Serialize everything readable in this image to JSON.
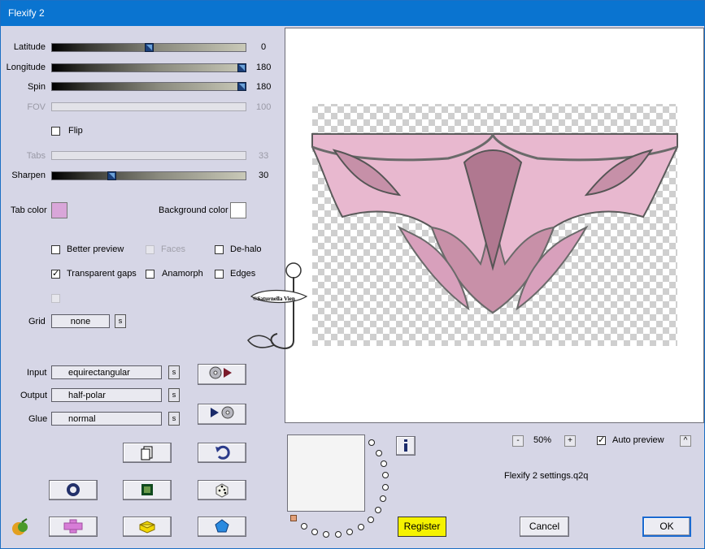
{
  "window": {
    "title": "Flexify 2"
  },
  "sliders": {
    "latitude": {
      "label": "Latitude",
      "value": "0",
      "fraction": 0.5
    },
    "longitude": {
      "label": "Longitude",
      "value": "180",
      "fraction": 1.0
    },
    "spin": {
      "label": "Spin",
      "value": "180",
      "fraction": 1.0
    },
    "fov": {
      "label": "FOV",
      "value": "100",
      "fraction": 1.0
    },
    "tabs": {
      "label": "Tabs",
      "value": "33",
      "fraction": 0.33
    },
    "sharpen": {
      "label": "Sharpen",
      "value": "30",
      "fraction": 0.3
    }
  },
  "checkboxes": {
    "flip": {
      "label": "Flip",
      "checked": false
    },
    "better_preview": {
      "label": "Better preview",
      "checked": false
    },
    "faces": {
      "label": "Faces",
      "checked": false
    },
    "de_halo": {
      "label": "De-halo",
      "checked": false
    },
    "transparent_gaps": {
      "label": "Transparent gaps",
      "checked": true
    },
    "anamorph": {
      "label": "Anamorph",
      "checked": false
    },
    "edges": {
      "label": "Edges",
      "checked": false
    },
    "auto_preview": {
      "label": "Auto preview",
      "checked": true
    }
  },
  "colors": {
    "tab_color_label": "Tab color",
    "tab_color": "#d9a6d9",
    "background_color_label": "Background color",
    "background_color": "#ffffff",
    "accent": "#1b6ad0",
    "title_bar": "#0a74d0"
  },
  "grid": {
    "label": "Grid",
    "value": "none"
  },
  "projections": {
    "input": {
      "label": "Input",
      "value": "equirectangular"
    },
    "output": {
      "label": "Output",
      "value": "half-polar"
    },
    "glue": {
      "label": "Glue",
      "value": "normal"
    }
  },
  "s_button": "s",
  "zoom": {
    "minus": "-",
    "value": "50%",
    "plus": "+"
  },
  "caret_label": "^",
  "settings_file": "Flexify 2 settings.q2q",
  "buttons": {
    "register": "Register",
    "cancel": "Cancel",
    "ok": "OK"
  },
  "icons": [
    "disc-play-icon",
    "play-disc-icon",
    "copy-icon",
    "undo-icon",
    "ring-icon",
    "square-frame-icon",
    "dice-icon",
    "pink-cross-icon",
    "yellow-block-icon",
    "blue-gem-icon",
    "fruit-logo-icon",
    "info-icon"
  ],
  "watermark": "©Saturnella Vien"
}
